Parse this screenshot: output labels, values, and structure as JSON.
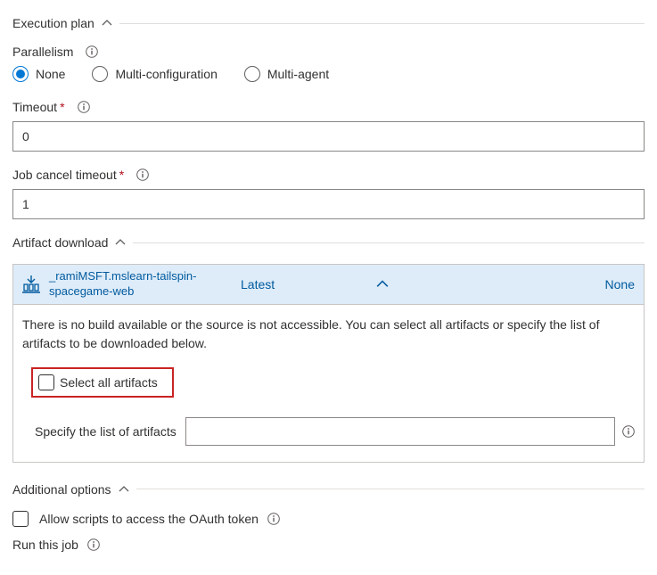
{
  "sections": {
    "execution_plan": "Execution plan",
    "artifact_download": "Artifact download",
    "additional_options": "Additional options"
  },
  "parallelism": {
    "label": "Parallelism",
    "options": {
      "none": "None",
      "multi_config": "Multi-configuration",
      "multi_agent": "Multi-agent"
    }
  },
  "timeout": {
    "label": "Timeout",
    "value": "0"
  },
  "job_cancel_timeout": {
    "label": "Job cancel timeout",
    "value": "1"
  },
  "artifact": {
    "name": "_ramiMSFT.mslearn-tailspin-spacegame-web",
    "version": "Latest",
    "selection": "None",
    "message": "There is no build available or the source is not accessible. You can select all artifacts or specify the list of artifacts to be downloaded below.",
    "select_all_label": "Select all artifacts",
    "specify_label": "Specify the list of artifacts"
  },
  "oauth": {
    "label": "Allow scripts to access the OAuth token"
  },
  "run_job": {
    "label": "Run this job"
  }
}
